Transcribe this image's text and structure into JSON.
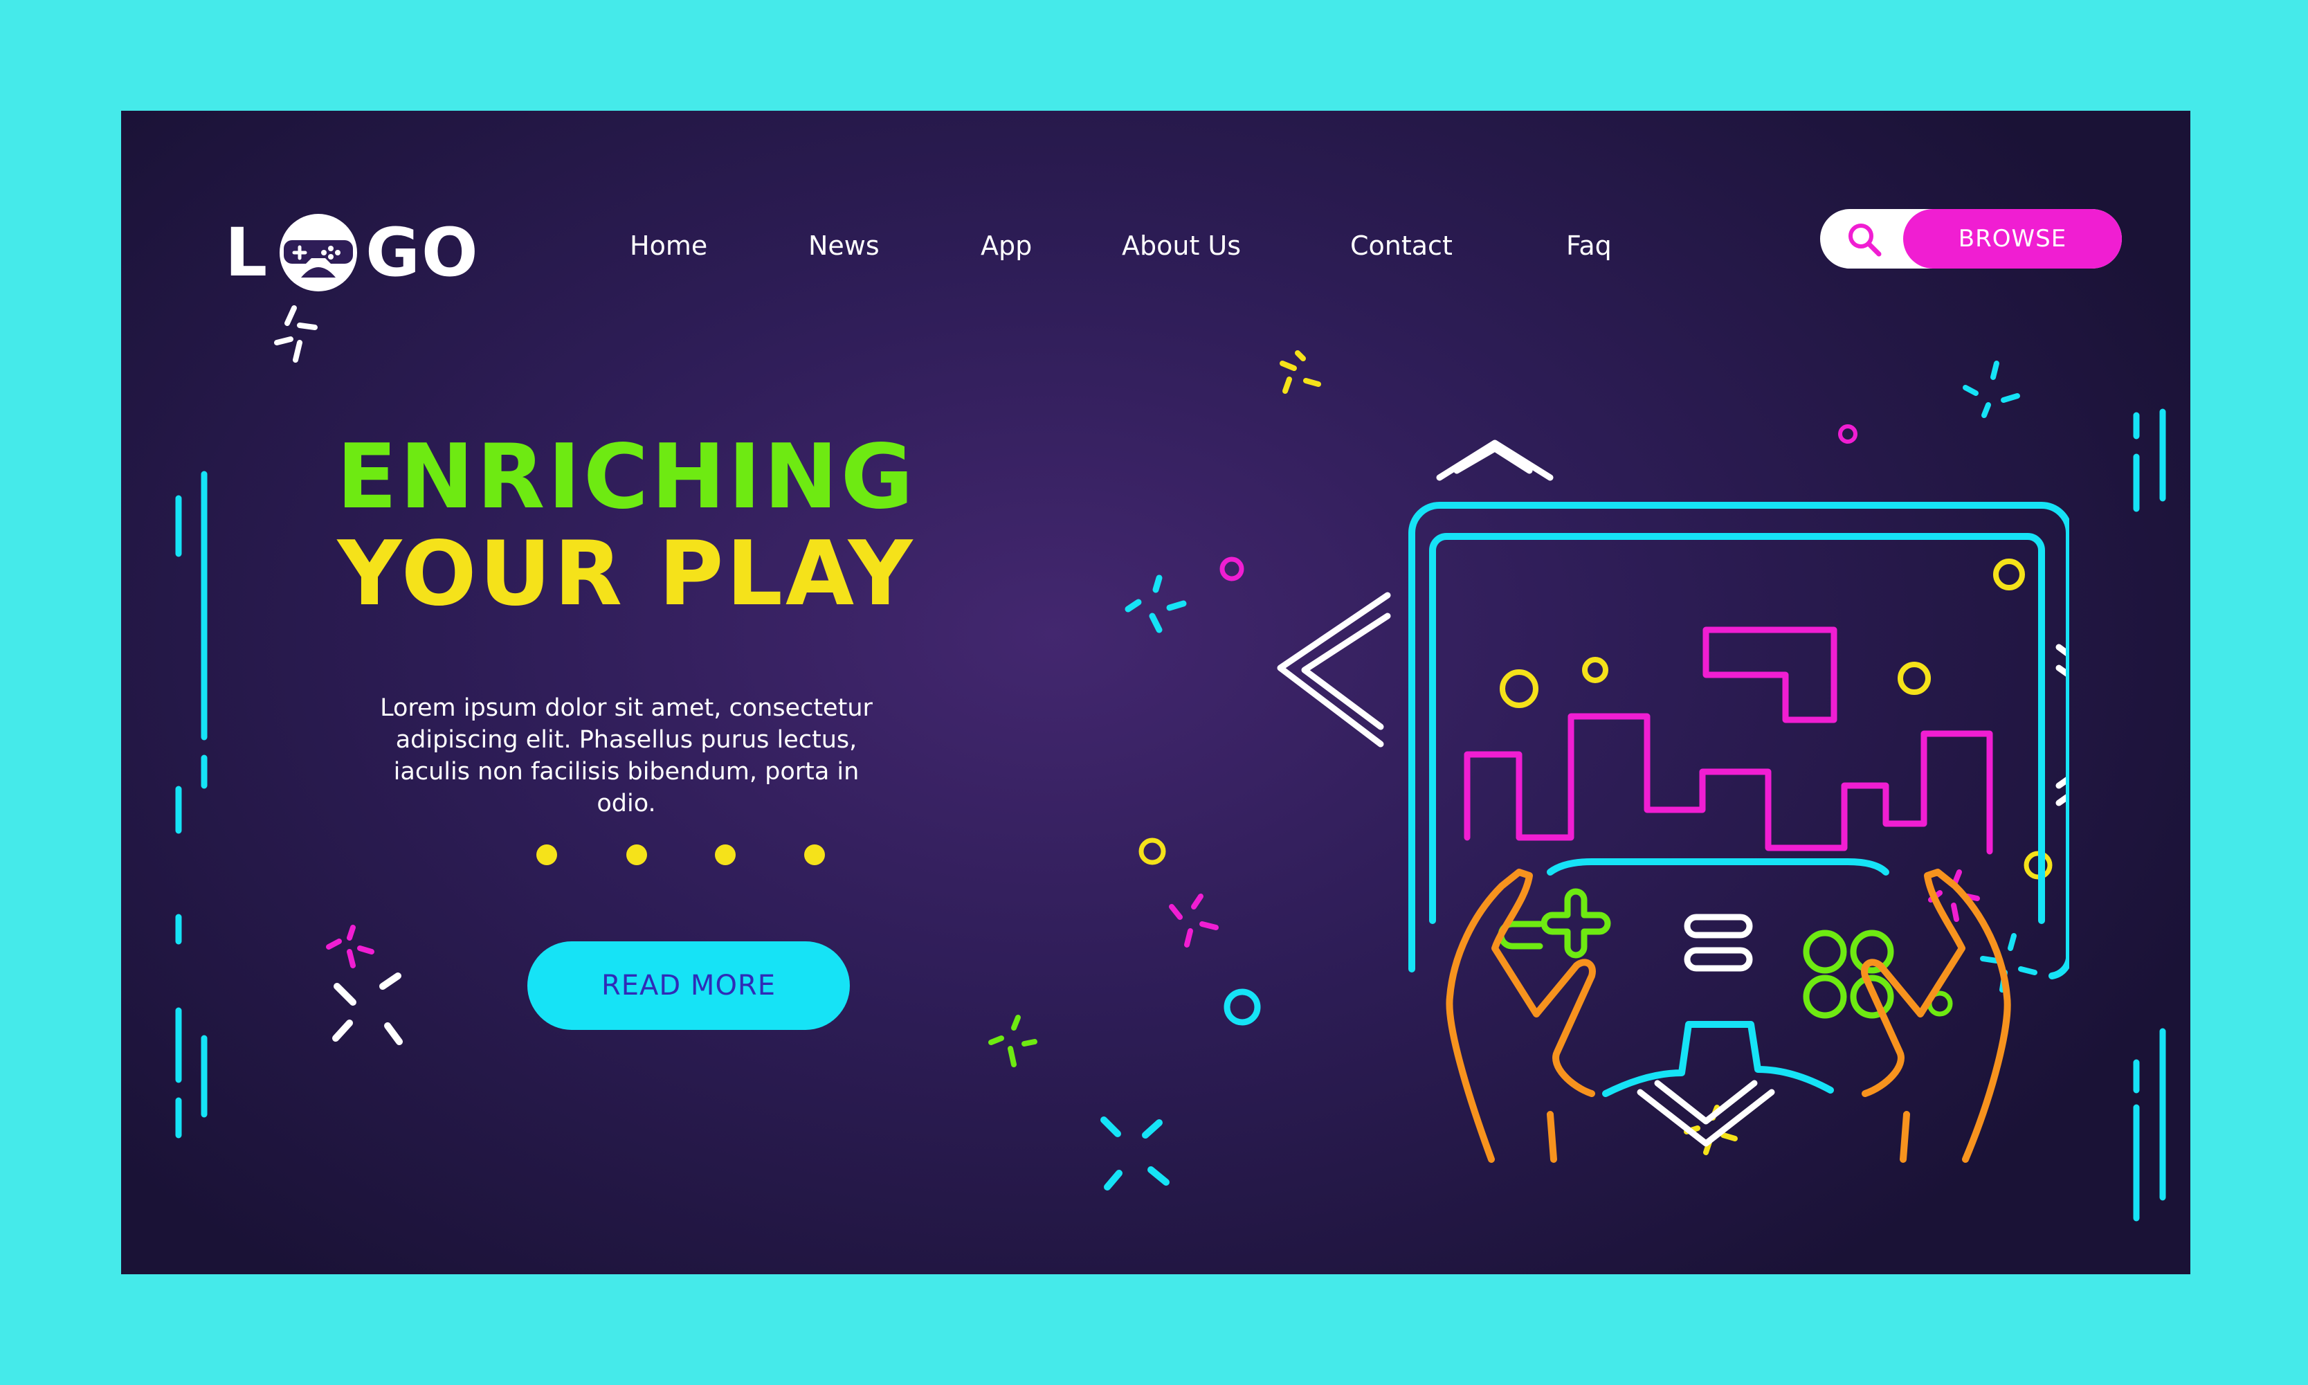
{
  "logo": {
    "text_left": "L",
    "text_right": "GO",
    "full": "LOGO"
  },
  "nav": [
    {
      "label": "Home"
    },
    {
      "label": "News"
    },
    {
      "label": "App"
    },
    {
      "label": "About Us"
    },
    {
      "label": "Contact"
    },
    {
      "label": "Faq"
    }
  ],
  "search": {
    "icon": "search-icon",
    "button_label": "BROWSE"
  },
  "hero": {
    "title_line1": "ENRICHING",
    "title_line2": "YOUR PLAY",
    "description": "Lorem ipsum dolor sit amet, consectetur adipiscing elit. Phasellus purus lectus, iaculis non facilisis bibendum, porta in odio.",
    "read_more": "READ MORE",
    "carousel_dots": 4
  },
  "colors": {
    "frame": "#45EAEA",
    "background": "#2e1d57",
    "green": "#6EEA12",
    "yellow": "#F5E21A",
    "magenta": "#F01ED2",
    "cyan": "#16E3F6",
    "orange": "#F7931E"
  },
  "illustration": {
    "icon": "game-controller-tablet-illustration"
  }
}
